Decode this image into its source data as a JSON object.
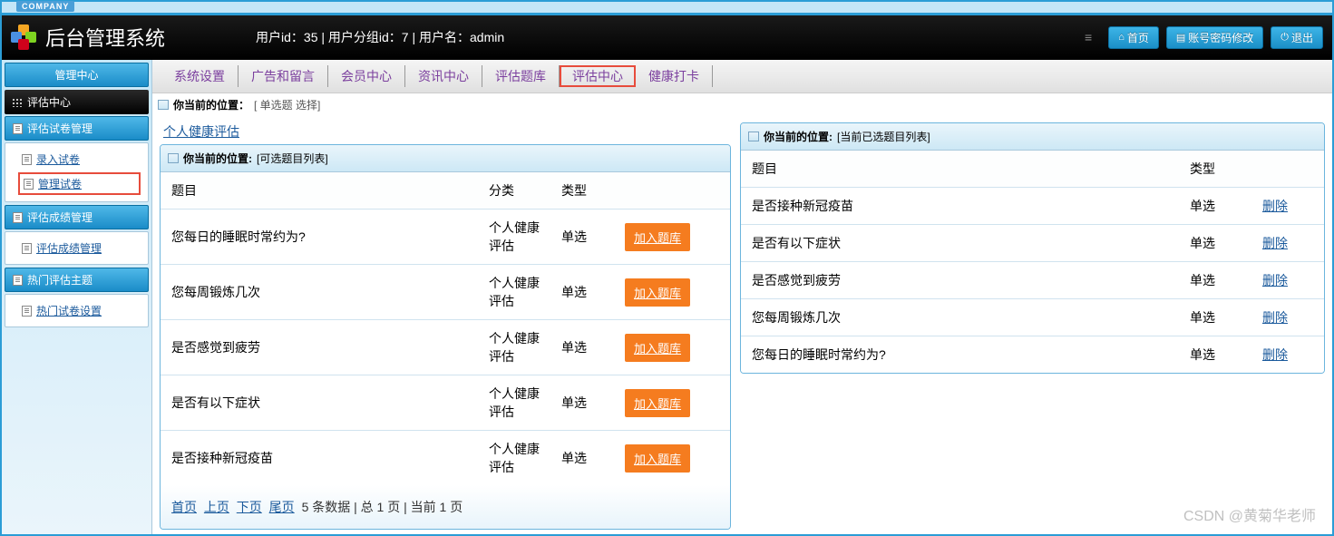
{
  "company_tag": "COMPANY",
  "app_title": "后台管理系统",
  "user_info": "用户id：35 | 用户分组id：7 | 用户名：admin",
  "top_buttons": {
    "home": "首页",
    "account": "账号密码修改",
    "logout": "退出"
  },
  "sidebar": {
    "header": "管理中心",
    "section": "评估中心",
    "groups": [
      {
        "title": "评估试卷管理",
        "items": [
          "录入试卷",
          "管理试卷"
        ],
        "highlight_index": 1
      },
      {
        "title": "评估成绩管理",
        "items": [
          "评估成绩管理"
        ]
      },
      {
        "title": "热门评估主题",
        "items": [
          "热门试卷设置"
        ]
      }
    ]
  },
  "menu": [
    "系统设置",
    "广告和留言",
    "会员中心",
    "资讯中心",
    "评估题库",
    "评估中心",
    "健康打卡"
  ],
  "menu_highlight_index": 5,
  "breadcrumb_top": {
    "label": "你当前的位置：",
    "value": "[ 单选题 选择]"
  },
  "link_top": "个人健康评估",
  "left_panel": {
    "head_label": "你当前的位置:",
    "head_value": "[可选题目列表]",
    "headers": [
      "题目",
      "分类",
      "类型",
      ""
    ],
    "rows": [
      {
        "q": "您每日的睡眠时常约为?",
        "cat": "个人健康评估",
        "type": "单选",
        "action": "加入题库"
      },
      {
        "q": "您每周锻炼几次",
        "cat": "个人健康评估",
        "type": "单选",
        "action": "加入题库"
      },
      {
        "q": "是否感觉到疲劳",
        "cat": "个人健康评估",
        "type": "单选",
        "action": "加入题库"
      },
      {
        "q": "是否有以下症状",
        "cat": "个人健康评估",
        "type": "单选",
        "action": "加入题库"
      },
      {
        "q": "是否接种新冠疫苗",
        "cat": "个人健康评估",
        "type": "单选",
        "action": "加入题库"
      }
    ],
    "pager": {
      "first": "首页",
      "prev": "上页",
      "next": "下页",
      "last": "尾页",
      "info": "5 条数据 | 总 1 页 | 当前 1 页"
    }
  },
  "right_panel": {
    "head_label": "你当前的位置:",
    "head_value": "[当前已选题目列表]",
    "headers": [
      "题目",
      "类型",
      ""
    ],
    "rows": [
      {
        "q": "是否接种新冠疫苗",
        "type": "单选",
        "action": "删除"
      },
      {
        "q": "是否有以下症状",
        "type": "单选",
        "action": "删除"
      },
      {
        "q": "是否感觉到疲劳",
        "type": "单选",
        "action": "删除"
      },
      {
        "q": "您每周锻炼几次",
        "type": "单选",
        "action": "删除"
      },
      {
        "q": "您每日的睡眠时常约为?",
        "type": "单选",
        "action": "删除"
      }
    ]
  },
  "watermark": "CSDN @黄菊华老师"
}
